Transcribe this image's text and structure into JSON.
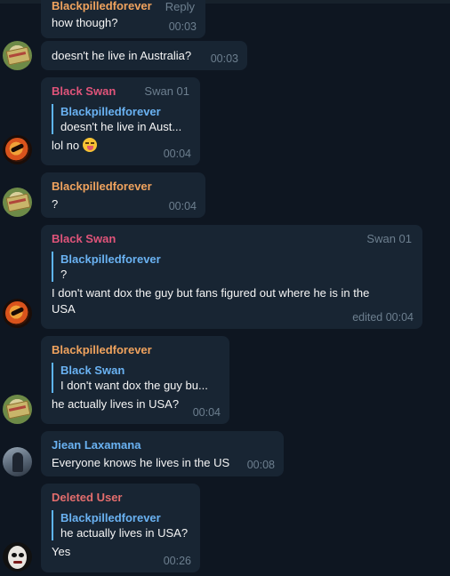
{
  "colors": {
    "background": "#0e1621",
    "bubble": "#182533",
    "blackpilled": "#f0a35e",
    "black_swan": "#e0547a",
    "jiean": "#6ab2f2",
    "deleted": "#e36d6d",
    "reply_accent": "#5eb5f7",
    "meta": "#6d7f8f"
  },
  "messages": [
    {
      "sender": "Blackpilledforever",
      "tag": "Reply",
      "text": "how though?",
      "time": "00:03"
    },
    {
      "text": "doesn't he live in Australia?",
      "time": "00:03",
      "avatar": "pill-avatar"
    },
    {
      "sender": "Black Swan",
      "tag": "Swan 01",
      "reply": {
        "name": "Blackpilledforever",
        "text": "doesn't he live in Aust..."
      },
      "text": "lol no",
      "emoji": "tongue-wink-emoji",
      "time": "00:04",
      "avatar": "swan-avatar"
    },
    {
      "sender": "Blackpilledforever",
      "text": "?",
      "time": "00:04",
      "avatar": "pill-avatar"
    },
    {
      "sender": "Black Swan",
      "tag": "Swan 01",
      "reply": {
        "name": "Blackpilledforever",
        "text": "?"
      },
      "text_line1": "I don't want dox the guy but fans figured out where he is in the",
      "text_line2": "USA",
      "time": "edited 00:04",
      "avatar": "swan-avatar"
    },
    {
      "sender": "Blackpilledforever",
      "reply": {
        "name": "Black Swan",
        "text": "I don't want dox the guy bu..."
      },
      "text": "he actually lives in USA?",
      "time": "00:04",
      "avatar": "pill-avatar"
    },
    {
      "sender": "Jiean Laxamana",
      "text": "Everyone knows he lives in the US",
      "time": "00:08",
      "avatar": "jiean-avatar"
    },
    {
      "sender": "Deleted User",
      "reply": {
        "name": "Blackpilledforever",
        "text": "he actually lives in USA?"
      },
      "text": "Yes",
      "time": "00:26",
      "avatar": "deleted-user-avatar"
    }
  ]
}
